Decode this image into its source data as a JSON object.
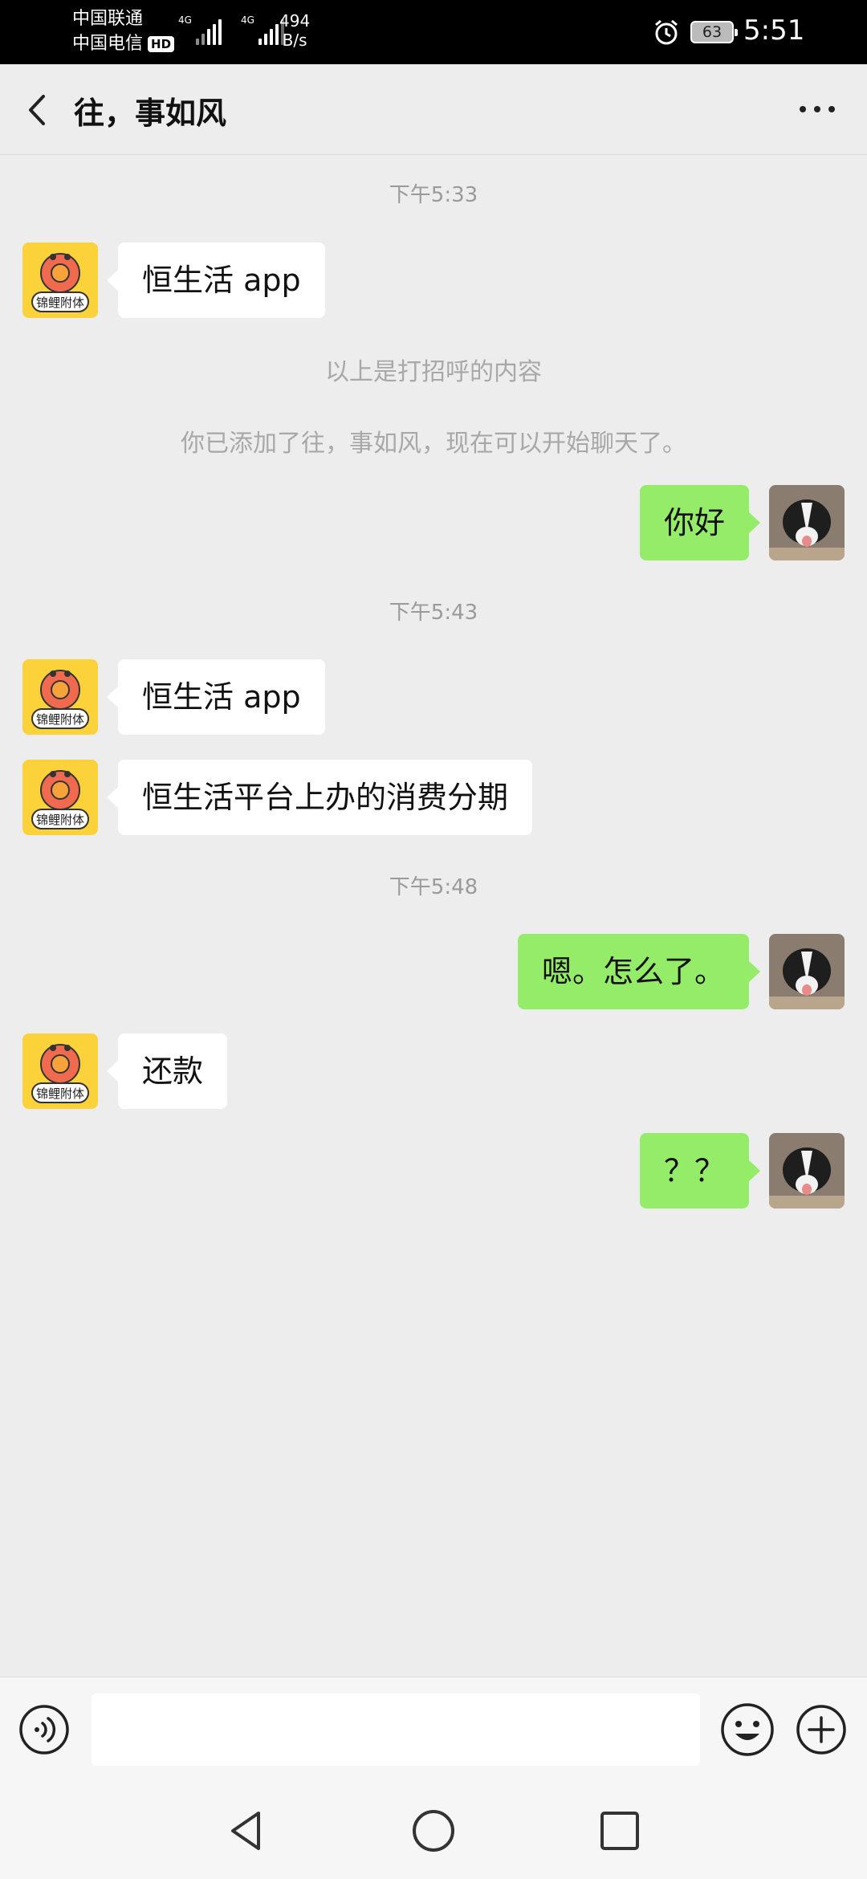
{
  "status_bar": {
    "carrier1": "中国联通",
    "carrier2": "中国电信",
    "hd_badge": "HD",
    "signal1_tag": "4G",
    "signal2_tag": "4G",
    "net_speed_value": "494",
    "net_speed_unit": "B/s",
    "battery": "63",
    "time": "5:51"
  },
  "header": {
    "title": "往，事如风"
  },
  "messages": [
    {
      "type": "time",
      "text": "下午5:33"
    },
    {
      "type": "incoming",
      "text": "恒生活 app"
    },
    {
      "type": "system",
      "text": "以上是打招呼的内容"
    },
    {
      "type": "system",
      "text": "你已添加了往，事如风，现在可以开始聊天了。"
    },
    {
      "type": "outgoing",
      "text": "你好"
    },
    {
      "type": "time",
      "text": "下午5:43"
    },
    {
      "type": "incoming",
      "text": "恒生活 app"
    },
    {
      "type": "incoming",
      "text": "恒生活平台上办的消费分期"
    },
    {
      "type": "time",
      "text": "下午5:48"
    },
    {
      "type": "outgoing",
      "text": "嗯。怎么了。"
    },
    {
      "type": "incoming",
      "text": "还款"
    },
    {
      "type": "outgoing",
      "text": "？？"
    }
  ],
  "contact_avatar": {
    "caption": "锦鲤附体"
  },
  "input": {
    "value": ""
  },
  "colors": {
    "outgoing_bubble": "#95ec69",
    "incoming_bubble": "#ffffff",
    "background": "#ededed"
  }
}
